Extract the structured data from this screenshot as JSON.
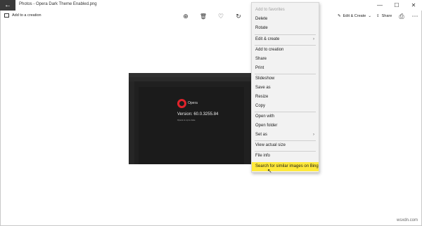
{
  "window": {
    "title": "Photos - Opera Dark Theme Enabled.png",
    "back": "←",
    "controls": [
      "—",
      "☐",
      "✕"
    ]
  },
  "toolbar": {
    "add_to_creation": "Add to a creation",
    "zoom": "⊕",
    "delete": "🗑",
    "favorite": "♡",
    "rotate": "↻",
    "edit_create": "Edit & Create",
    "edit_chev": "⌄",
    "share": "Share",
    "print": "⎙",
    "more": "⋯"
  },
  "photo": {
    "app_name": "Opera",
    "version": "Version: 60.0.3255.84",
    "version_sub": "Opera is up to date"
  },
  "context_menu": {
    "items": [
      {
        "label": "Add to favorites",
        "disabled": true
      },
      {
        "label": "Delete"
      },
      {
        "label": "Rotate"
      },
      {
        "label": "Edit & create",
        "submenu": true
      },
      {
        "label": "Add to creation"
      },
      {
        "label": "Share"
      },
      {
        "label": "Print"
      },
      {
        "label": "Slideshow"
      },
      {
        "label": "Save as"
      },
      {
        "label": "Resize"
      },
      {
        "label": "Copy"
      },
      {
        "label": "Open with"
      },
      {
        "label": "Open folder"
      },
      {
        "label": "Set as",
        "submenu": true
      },
      {
        "label": "View actual size"
      },
      {
        "label": "File info"
      },
      {
        "label": "Search for similar images on Bing",
        "highlighted": true
      }
    ],
    "chevron": "›"
  },
  "watermark": "wsxdn.com",
  "colors": {
    "highlight": "#ffe93b",
    "titlebar_back": "#3a3a3a",
    "opera_red": "#e0232b"
  }
}
